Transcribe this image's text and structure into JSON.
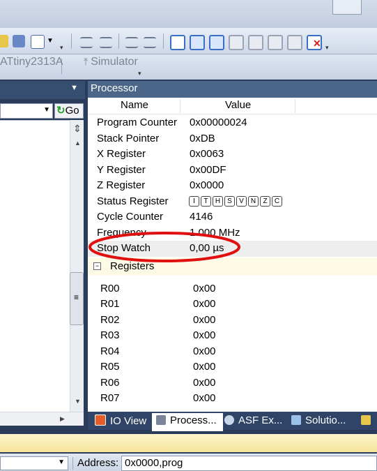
{
  "toolbar": {
    "device": "ATtiny2313A",
    "tool": "Simulator"
  },
  "left_pane": {
    "go_label": "Go"
  },
  "processor": {
    "title": "Processor",
    "col_name": "Name",
    "col_value": "Value",
    "rows": [
      {
        "name": "Program Counter",
        "value": "0x00000024"
      },
      {
        "name": "Stack Pointer",
        "value": "0xDB"
      },
      {
        "name": "X Register",
        "value": "0x0063"
      },
      {
        "name": "Y Register",
        "value": "0x00DF"
      },
      {
        "name": "Z Register",
        "value": "0x0000"
      },
      {
        "name": "Status Register",
        "flags": [
          "I",
          "T",
          "H",
          "S",
          "V",
          "N",
          "Z",
          "C"
        ]
      },
      {
        "name": "Cycle Counter",
        "value": "4146"
      },
      {
        "name": "Frequency",
        "value": "1.000 MHz"
      },
      {
        "name": "Stop Watch",
        "value": "0,00 µs"
      }
    ],
    "registers_group": "Registers",
    "registers": [
      {
        "name": "R00",
        "value": "0x00"
      },
      {
        "name": "R01",
        "value": "0x00"
      },
      {
        "name": "R02",
        "value": "0x00"
      },
      {
        "name": "R03",
        "value": "0x00"
      },
      {
        "name": "R04",
        "value": "0x00"
      },
      {
        "name": "R05",
        "value": "0x00"
      },
      {
        "name": "R06",
        "value": "0x00"
      },
      {
        "name": "R07",
        "value": "0x00"
      }
    ]
  },
  "tabs": [
    {
      "label": "IO View",
      "icon": "io-view-icon"
    },
    {
      "label": "Process...",
      "icon": "processor-icon",
      "active": true
    },
    {
      "label": "ASF Ex...",
      "icon": "asf-explorer-icon"
    },
    {
      "label": "Solutio...",
      "icon": "solution-icon"
    }
  ],
  "bottom": {
    "address_label": "Address:",
    "address_value": "0x0000,prog"
  },
  "annotation": {
    "color": "#e01010"
  }
}
